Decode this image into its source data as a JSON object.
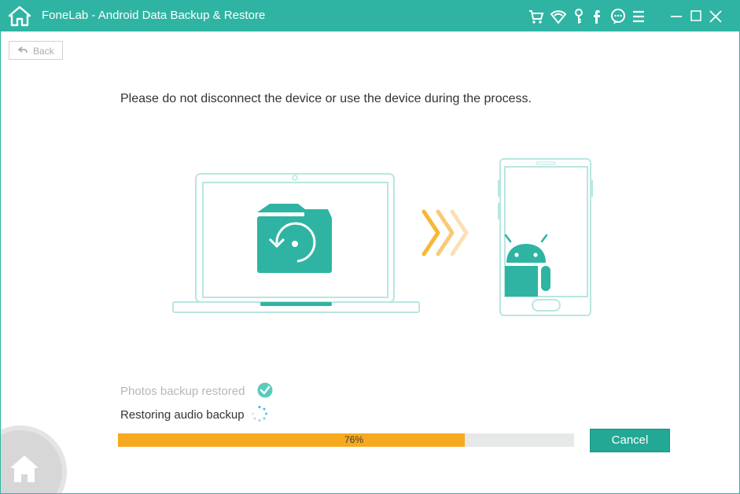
{
  "window": {
    "title": "FoneLab - Android Data Backup & Restore"
  },
  "toolbar": {
    "back_label": "Back"
  },
  "content": {
    "instruction": "Please do not disconnect the device or use the device during the process.",
    "status": {
      "done_label": "Photos backup restored",
      "current_label": "Restoring audio backup"
    },
    "progress": {
      "percent": 76,
      "percent_label": "76%"
    },
    "cancel_label": "Cancel"
  },
  "icons": {
    "home": "home-icon",
    "cart": "cart-icon",
    "wifi": "wifi-icon",
    "key": "key-icon",
    "facebook": "facebook-icon",
    "chat": "chat-icon",
    "menu": "menu-icon",
    "minimize": "minimize-icon",
    "maximize": "maximize-icon",
    "close": "close-icon",
    "back": "back-arrow-icon",
    "check": "check-icon",
    "spinner": "spinner-icon",
    "android": "android-icon",
    "camera": "camera-restore-icon"
  },
  "colors": {
    "accent": "#2fb4a3",
    "progress": "#f7a91f",
    "muted": "#b5b8b8"
  }
}
